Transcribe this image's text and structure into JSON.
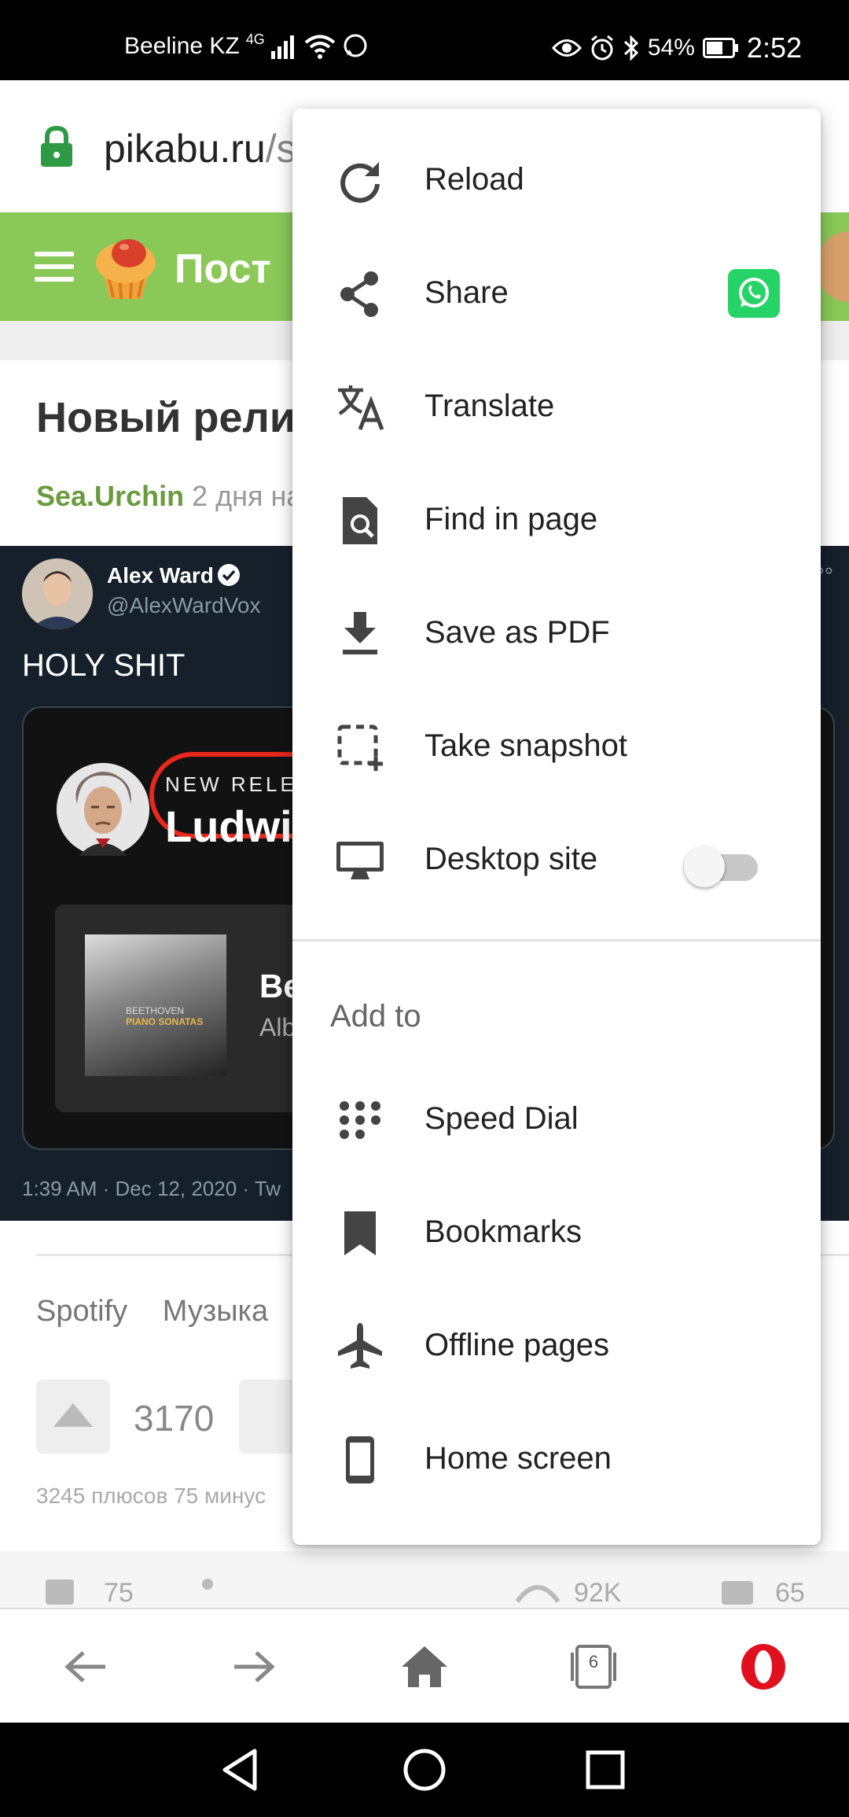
{
  "status_bar": {
    "carrier": "Beeline KZ",
    "network": "4G",
    "battery": "54%",
    "time": "2:52"
  },
  "address_bar": {
    "domain": "pikabu.ru",
    "path": "/s"
  },
  "site_header": {
    "title": "Пост"
  },
  "post": {
    "title": "Новый рели",
    "author": "Sea.Urchin",
    "time": "2 дня на",
    "tweet": {
      "name": "Alex Ward",
      "handle": "@AlexWardVox",
      "text": "HOLY SHIT",
      "card_tag": "NEW RELEA",
      "card_artist": "Ludwig",
      "album_name": "Be",
      "album_sub": "Alb",
      "cover_line1": "BEETHOVEN",
      "cover_line2": "PIANO SONATAS",
      "footer": "1:39 AM · Dec 12, 2020 · Tw"
    },
    "tags": [
      "Spotify",
      "Музыка"
    ],
    "score": "3170",
    "vote_stats": "3245 плюсов 75 минус",
    "actions": {
      "saves": "75",
      "views": "92K",
      "comments": "65"
    }
  },
  "menu": {
    "items": [
      {
        "label": "Reload",
        "icon": "reload-icon"
      },
      {
        "label": "Share",
        "icon": "share-icon"
      },
      {
        "label": "Translate",
        "icon": "translate-icon"
      },
      {
        "label": "Find in page",
        "icon": "find-in-page-icon"
      },
      {
        "label": "Save as PDF",
        "icon": "download-icon"
      },
      {
        "label": "Take snapshot",
        "icon": "snapshot-icon"
      },
      {
        "label": "Desktop site",
        "icon": "desktop-icon"
      }
    ],
    "section_title": "Add to",
    "add_items": [
      {
        "label": "Speed Dial",
        "icon": "speed-dial-icon"
      },
      {
        "label": "Bookmarks",
        "icon": "bookmark-icon"
      },
      {
        "label": "Offline pages",
        "icon": "airplane-icon"
      },
      {
        "label": "Home screen",
        "icon": "phone-icon"
      }
    ],
    "desktop_site_enabled": false
  },
  "bottom_bar": {
    "tab_count": "6"
  },
  "colors": {
    "pikabu_green": "#8ac858",
    "opera_red": "#e0101e",
    "whatsapp_green": "#25d366"
  }
}
